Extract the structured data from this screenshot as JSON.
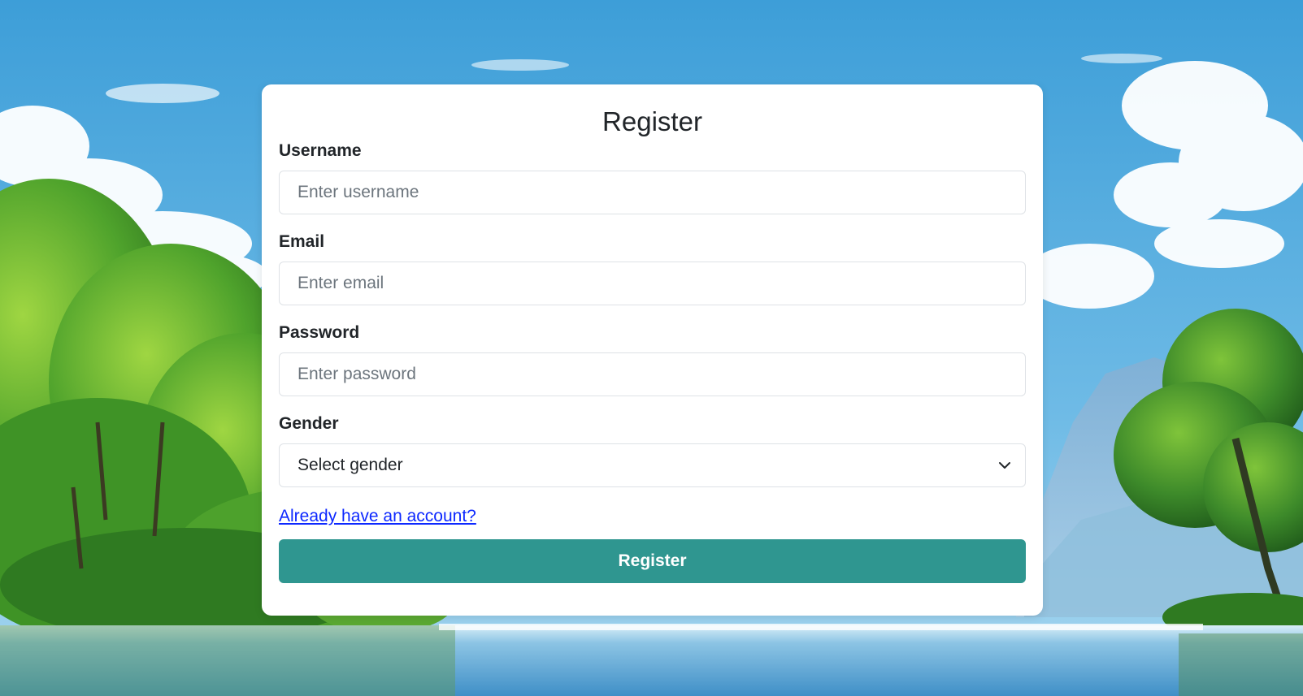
{
  "form": {
    "title": "Register",
    "fields": [
      {
        "label": "Username",
        "placeholder": "Enter username",
        "type": "text"
      },
      {
        "label": "Email",
        "placeholder": "Enter email",
        "type": "email"
      },
      {
        "label": "Password",
        "placeholder": "Enter password",
        "type": "password"
      }
    ],
    "gender": {
      "label": "Gender",
      "selected": "Select gender"
    },
    "login_link": "Already have an account?",
    "submit_label": "Register"
  },
  "colors": {
    "submit_button": "#2f9690",
    "link": "#0d28ff",
    "card": "#ffffff"
  },
  "icons": {
    "select_chevron": "chevron-down-icon"
  }
}
